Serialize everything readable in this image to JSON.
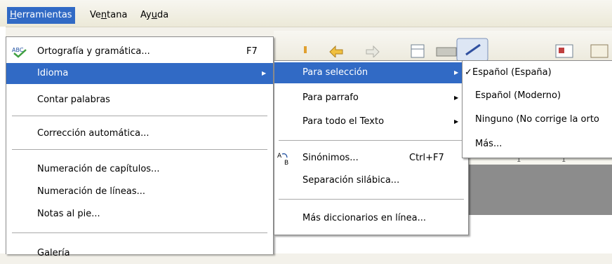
{
  "menubar": {
    "items": [
      {
        "label": "Herramientas"
      },
      {
        "label": "Ventana"
      },
      {
        "label": "Ayuda"
      }
    ]
  },
  "herramientas_menu": {
    "items": [
      {
        "label": "Ortografía y gramática...",
        "shortcut": "F7",
        "icon": "spellcheck-icon"
      },
      {
        "label": "Idioma",
        "submenu": true
      },
      {
        "label": "Contar palabras"
      },
      {
        "label": "Corrección automática..."
      },
      {
        "label": "Numeración de capítulos..."
      },
      {
        "label": "Numeración de líneas..."
      },
      {
        "label": "Notas al pie..."
      },
      {
        "label": "Galería"
      }
    ]
  },
  "idioma_menu": {
    "items": [
      {
        "label": "Para selección",
        "submenu": true
      },
      {
        "label": "Para parrafo",
        "submenu": true
      },
      {
        "label": "Para todo el Texto",
        "submenu": true
      },
      {
        "label": "Sinónimos...",
        "shortcut": "Ctrl+F7",
        "icon": "thesaurus-icon"
      },
      {
        "label": "Separación silábica..."
      },
      {
        "label": "Más diccionarios en línea..."
      }
    ]
  },
  "seleccion_menu": {
    "items": [
      {
        "label": "Español (España)",
        "checked": true
      },
      {
        "label": "Español (Moderno)"
      },
      {
        "label": "Ninguno (No corrige la orto"
      },
      {
        "label": "Más..."
      }
    ]
  },
  "ruler": {
    "marks": [
      "1",
      "1"
    ]
  },
  "colors": {
    "highlight": "#316ac5",
    "menu_bg": "#ffffff",
    "separator": "#a9a9a9"
  }
}
